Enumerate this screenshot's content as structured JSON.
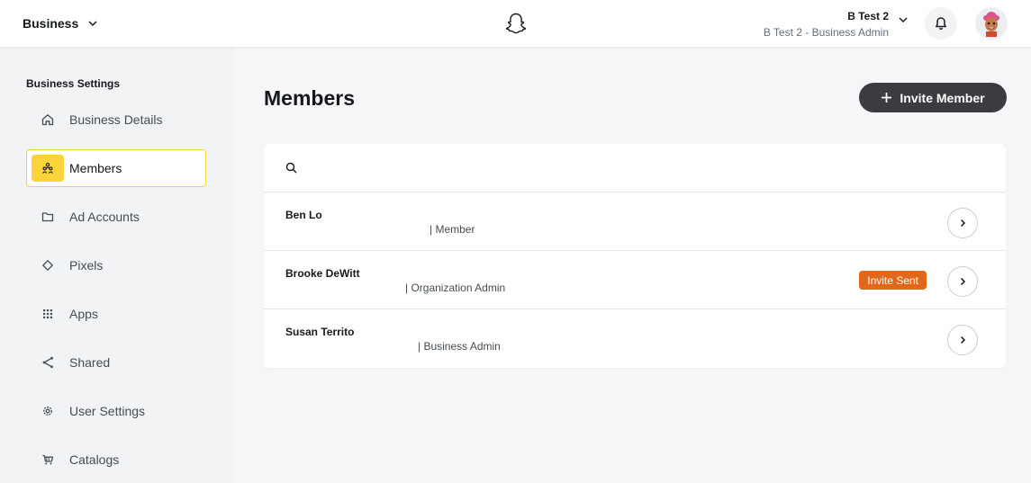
{
  "header": {
    "business_label": "Business",
    "user_name": "B Test 2",
    "user_role": "B Test 2 - Business Admin",
    "icons": [
      "chevron-down-icon",
      "snapchat-ghost-icon",
      "bell-icon",
      "bitmoji-avatar"
    ]
  },
  "sidebar": {
    "heading": "Business Settings",
    "items": [
      {
        "label": "Business Details",
        "icon": "home-icon"
      },
      {
        "label": "Members",
        "icon": "members-icon",
        "active": true
      },
      {
        "label": "Ad Accounts",
        "icon": "folder-icon"
      },
      {
        "label": "Pixels",
        "icon": "diamond-icon"
      },
      {
        "label": "Apps",
        "icon": "grid-icon"
      },
      {
        "label": "Shared",
        "icon": "share-icon"
      },
      {
        "label": "User Settings",
        "icon": "gear-icon"
      },
      {
        "label": "Catalogs",
        "icon": "cart-icon"
      }
    ]
  },
  "main": {
    "title": "Members",
    "invite_button": "Invite Member",
    "search": {
      "placeholder": "",
      "value": ""
    },
    "members": [
      {
        "name": "Ben Lo",
        "role": "| Member",
        "badge": ""
      },
      {
        "name": "Brooke DeWitt",
        "role": "| Organization Admin",
        "badge": "Invite Sent"
      },
      {
        "name": "Susan Territo",
        "role": "| Business Admin",
        "badge": ""
      }
    ]
  },
  "colors": {
    "accent_yellow": "#fcd33a",
    "badge_orange": "#e1671b",
    "button_dark": "#3a3c40"
  }
}
